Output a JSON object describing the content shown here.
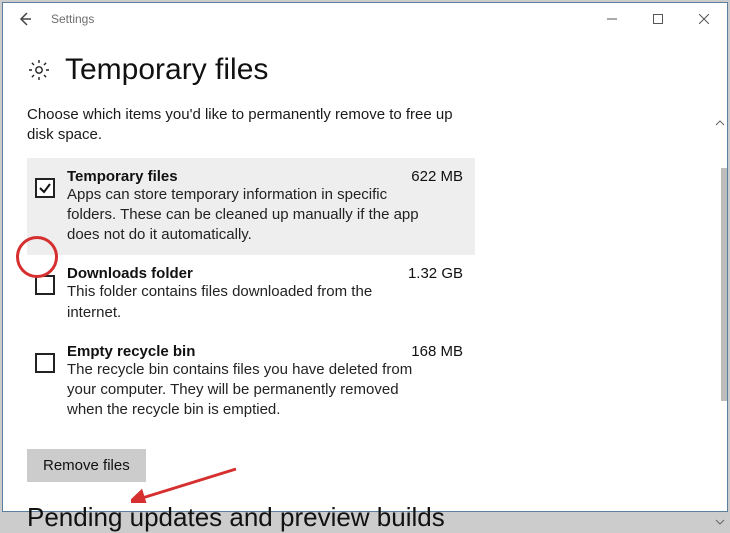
{
  "window": {
    "title": "Settings"
  },
  "page": {
    "heading": "Temporary files",
    "intro": "Choose which items you'd like to permanently remove to free up disk space."
  },
  "items": [
    {
      "title": "Temporary files",
      "size": "622 MB",
      "desc": "Apps can store temporary information in specific folders. These can be cleaned up manually if the app does not do it automatically.",
      "checked": true,
      "selected": true
    },
    {
      "title": "Downloads folder",
      "size": "1.32 GB",
      "desc": "This folder contains files downloaded from the internet.",
      "checked": false,
      "selected": false
    },
    {
      "title": "Empty recycle bin",
      "size": "168 MB",
      "desc": "The recycle bin contains files you have deleted from your computer. They will be permanently removed when the recycle bin is emptied.",
      "checked": false,
      "selected": false
    }
  ],
  "buttons": {
    "remove": "Remove files"
  },
  "subheading": "Pending updates and preview builds"
}
